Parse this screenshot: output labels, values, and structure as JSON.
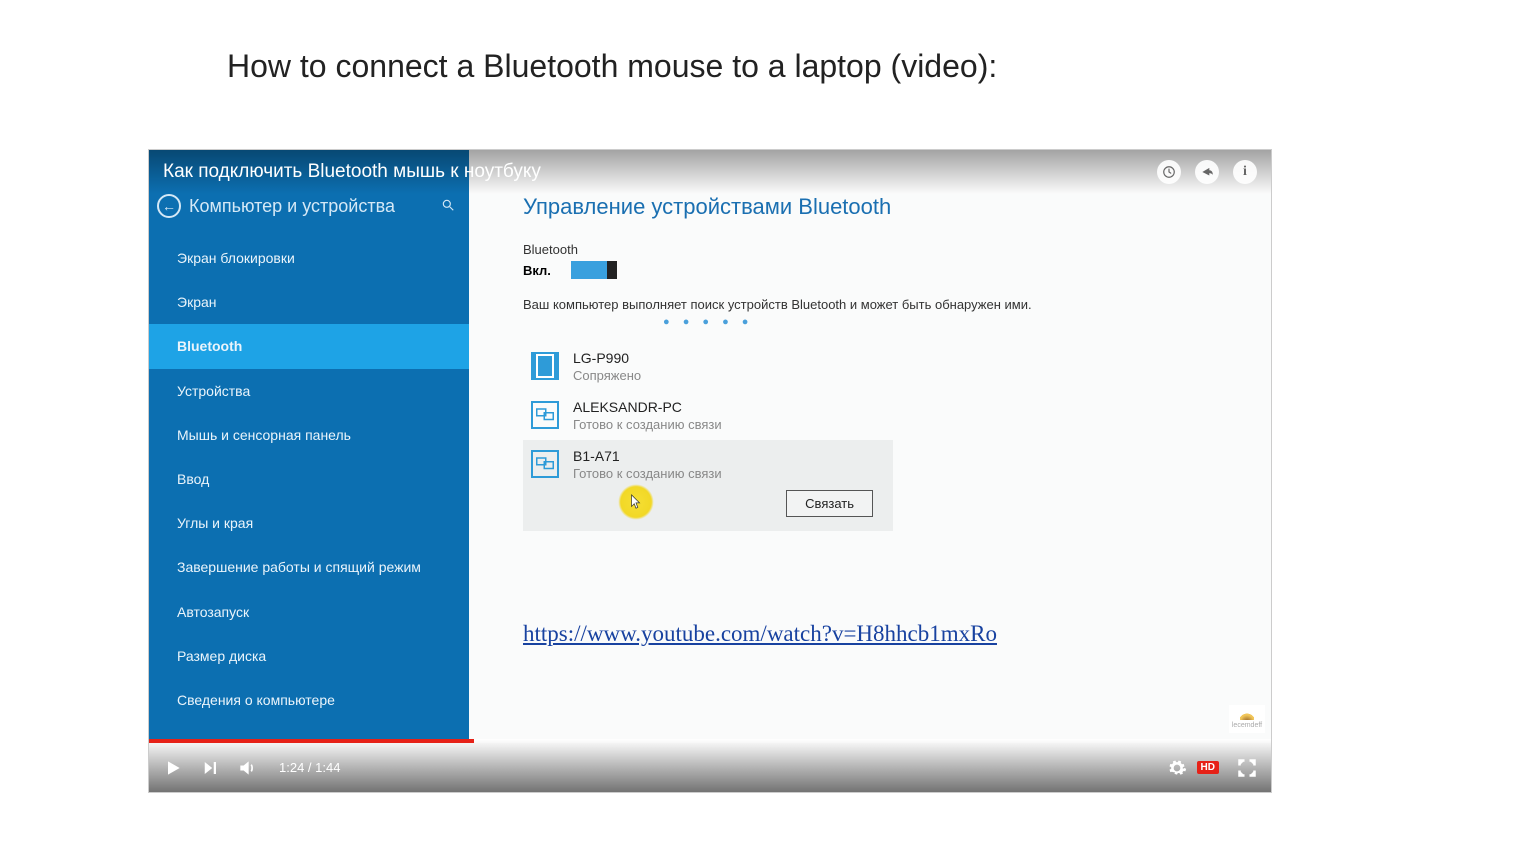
{
  "page": {
    "title": "How to connect a Bluetooth mouse to a laptop (video):"
  },
  "video": {
    "title": "Как подключить Bluetooth мышь к ноутбуку",
    "current_time": "1:24",
    "duration": "1:44",
    "time_label": "1:24 / 1:44",
    "progress_percent": 29,
    "link_text": "https://www.youtube.com/watch?v=H8hhcb1mxRo",
    "watermark": "lecemdeff"
  },
  "sidebar": {
    "header": "Компьютер и устройства",
    "items": [
      {
        "label": "Экран блокировки",
        "active": false
      },
      {
        "label": "Экран",
        "active": false
      },
      {
        "label": "Bluetooth",
        "active": true
      },
      {
        "label": "Устройства",
        "active": false
      },
      {
        "label": "Мышь и сенсорная панель",
        "active": false
      },
      {
        "label": "Ввод",
        "active": false
      },
      {
        "label": "Углы и края",
        "active": false
      },
      {
        "label": "Завершение работы и спящий режим",
        "active": false
      },
      {
        "label": "Автозапуск",
        "active": false
      },
      {
        "label": "Размер диска",
        "active": false
      },
      {
        "label": "Сведения о компьютере",
        "active": false
      }
    ]
  },
  "panel": {
    "heading": "Управление устройствами Bluetooth",
    "toggle_label": "Bluetooth",
    "toggle_state": "Вкл.",
    "status_text": "Ваш компьютер выполняет поиск устройств Bluetooth и может быть обнаружен ими.",
    "connect_button": "Связать",
    "devices": [
      {
        "name": "LG-P990",
        "status": "Сопряжено",
        "type": "phone",
        "selected": false
      },
      {
        "name": "ALEKSANDR-PC",
        "status": "Готово к созданию связи",
        "type": "pc",
        "selected": false
      },
      {
        "name": "B1-A71",
        "status": "Готово к созданию связи",
        "type": "pc",
        "selected": true
      }
    ]
  }
}
